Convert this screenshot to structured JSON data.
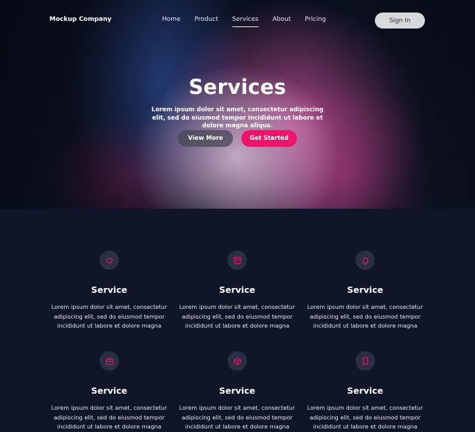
{
  "brand": "Mockup Company",
  "nav": {
    "items": [
      {
        "label": "Home"
      },
      {
        "label": "Product"
      },
      {
        "label": "Services"
      },
      {
        "label": "About"
      },
      {
        "label": "Pricing"
      }
    ],
    "active": "Services",
    "signin_label": "Sign In"
  },
  "hero": {
    "title": "Services",
    "subtitle": "Lorem ipsum dolor sit amet, consectetur adipiscing elit, sed do eiusmod tempor incididunt ut labore et dolore magna aliqua.",
    "view_more_label": "View More",
    "get_started_label": "Get Started"
  },
  "services": {
    "cards": [
      {
        "icon": "heart-icon",
        "title": "Service",
        "text": "Lorem ipsum dolor sit amet, consectetur adipiscing elit, sed do eiusmod tempor incididunt ut labore et dolore magna"
      },
      {
        "icon": "archive-icon",
        "title": "Service",
        "text": "Lorem ipsum dolor sit amet, consectetur adipiscing elit, sed do eiusmod tempor incididunt ut labore et dolore magna"
      },
      {
        "icon": "bell-icon",
        "title": "Service",
        "text": "Lorem ipsum dolor sit amet, consectetur adipiscing elit, sed do eiusmod tempor incididunt ut labore et dolore magna"
      },
      {
        "icon": "briefcase-icon",
        "title": "Service",
        "text": "Lorem ipsum dolor sit amet, consectetur adipiscing elit, sed do eiusmod tempor incididunt ut labore et dolore magna"
      },
      {
        "icon": "cube-icon",
        "title": "Service",
        "text": "Lorem ipsum dolor sit amet, consectetur adipiscing elit, sed do eiusmod tempor incididunt ut labore et dolore magna"
      },
      {
        "icon": "bookmark-icon",
        "title": "Service",
        "text": "Lorem ipsum dolor sit amet, consectetur adipiscing elit, sed do eiusmod tempor incididunt ut labore et dolore magna"
      }
    ]
  },
  "colors": {
    "accent": "#f0136a",
    "background": "#10152a",
    "icon_bg": "#2a2f45",
    "signin_bg": "#d9d9dc"
  }
}
